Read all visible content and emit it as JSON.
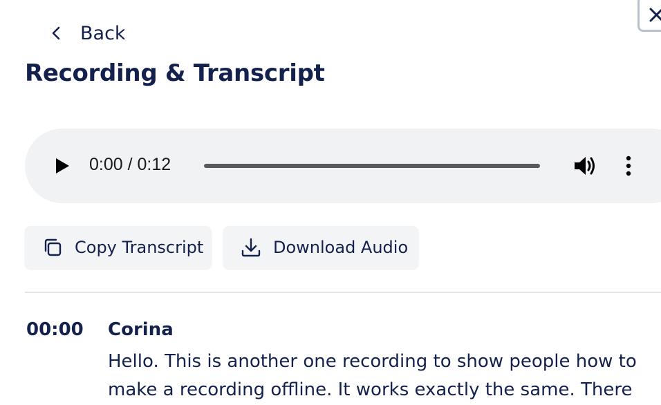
{
  "navigation": {
    "back_label": "Back"
  },
  "header": {
    "title": "Recording & Transcript"
  },
  "audio_player": {
    "time_display": "0:00 / 0:12",
    "progress_fraction": 0
  },
  "actions": {
    "copy_label": "Copy Transcript",
    "download_label": "Download Audio"
  },
  "transcript": {
    "entries": [
      {
        "timestamp": "00:00",
        "speaker": "Corina",
        "text": "Hello. This is another one recording to show people how to make a recording offline. It works exactly the same. There"
      }
    ]
  },
  "icons": {
    "close": "close-icon",
    "back": "chevron-left-icon",
    "play": "play-icon",
    "volume": "volume-icon",
    "more": "more-vertical-icon",
    "copy": "copy-icon",
    "download": "download-icon"
  },
  "colors": {
    "text_primary": "#14214d",
    "player_background": "#f1f2f4",
    "button_background": "#f3f4f6",
    "divider": "#e3e5ea"
  }
}
